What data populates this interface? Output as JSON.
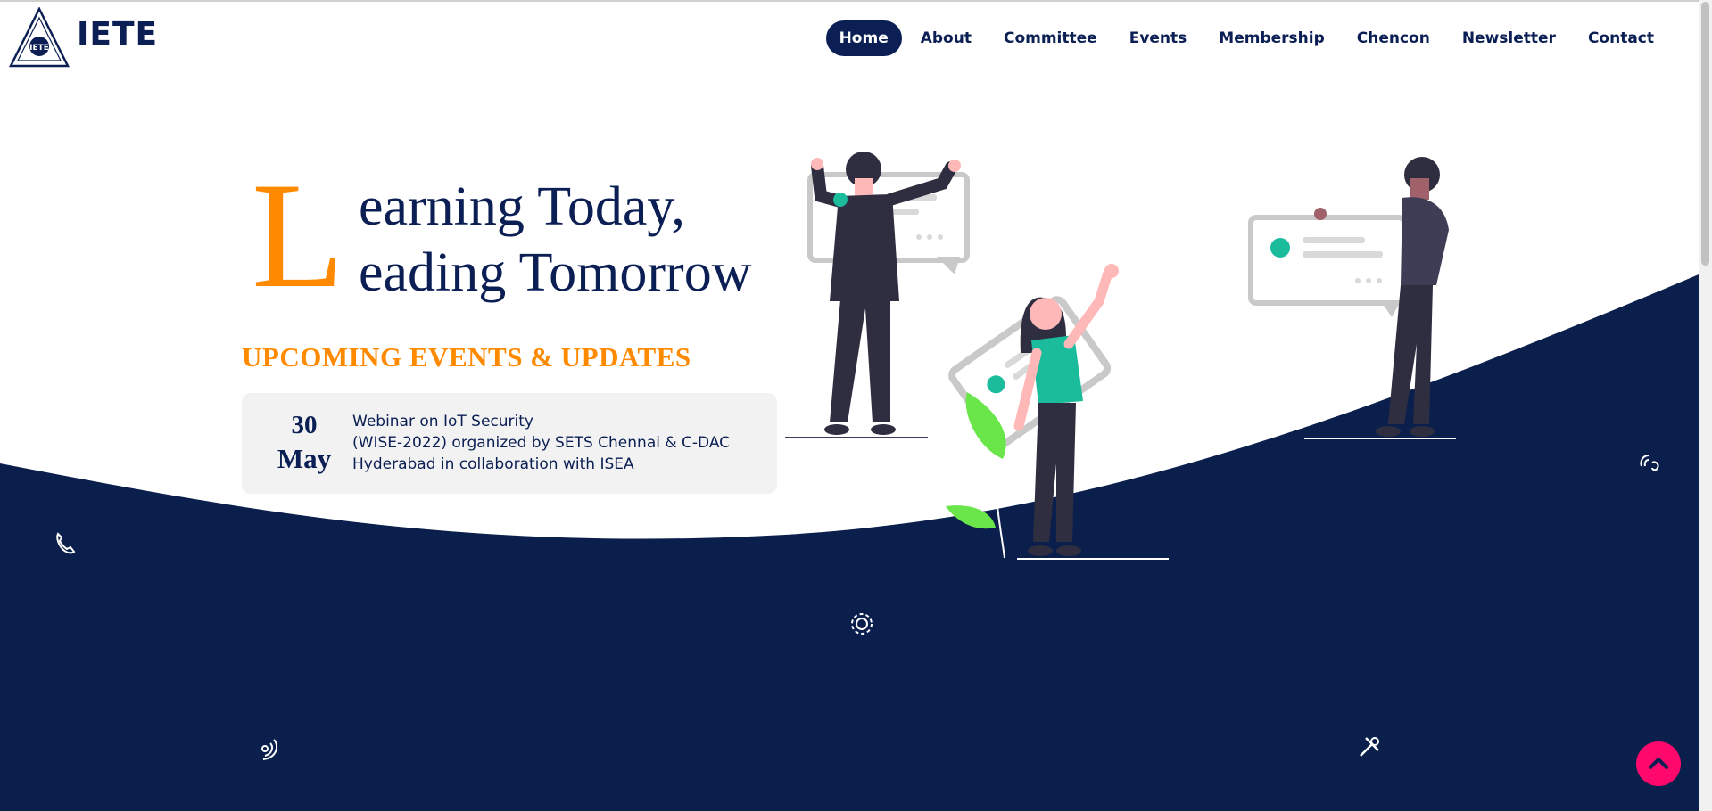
{
  "brand": {
    "name": "IETE",
    "logo_icon": "iete-logo-icon",
    "logo_text": "IETE"
  },
  "nav": {
    "items": [
      {
        "label": "Home",
        "active": true
      },
      {
        "label": "About"
      },
      {
        "label": "Committee"
      },
      {
        "label": "Events"
      },
      {
        "label": "Membership"
      },
      {
        "label": "Chencon"
      },
      {
        "label": "Newsletter"
      },
      {
        "label": "Contact"
      }
    ]
  },
  "hero": {
    "initial": "L",
    "line1": "earning Today,",
    "line2": "eading Tomorrow"
  },
  "updates": {
    "heading": "UPCOMING EVENTS & UPDATES",
    "events": [
      {
        "day": "30",
        "month": "May",
        "lines": [
          "Webinar on IoT Security",
          "(WISE-2022) organized by SETS Chennai & C-DAC",
          "Hyderabad in collaboration with ISEA"
        ]
      }
    ]
  },
  "floating_icons": [
    "phone-icon",
    "gear-icon",
    "wifi-signal-icon",
    "tools-icon",
    "signal-waves-icon"
  ],
  "back_to_top": {
    "icon": "chevron-up-icon"
  },
  "colors": {
    "navy": "#0b1f54",
    "orange": "#ff8a00",
    "pink": "#ff0a6c",
    "teal": "#1abc9c",
    "card": "#f2f2f2"
  }
}
